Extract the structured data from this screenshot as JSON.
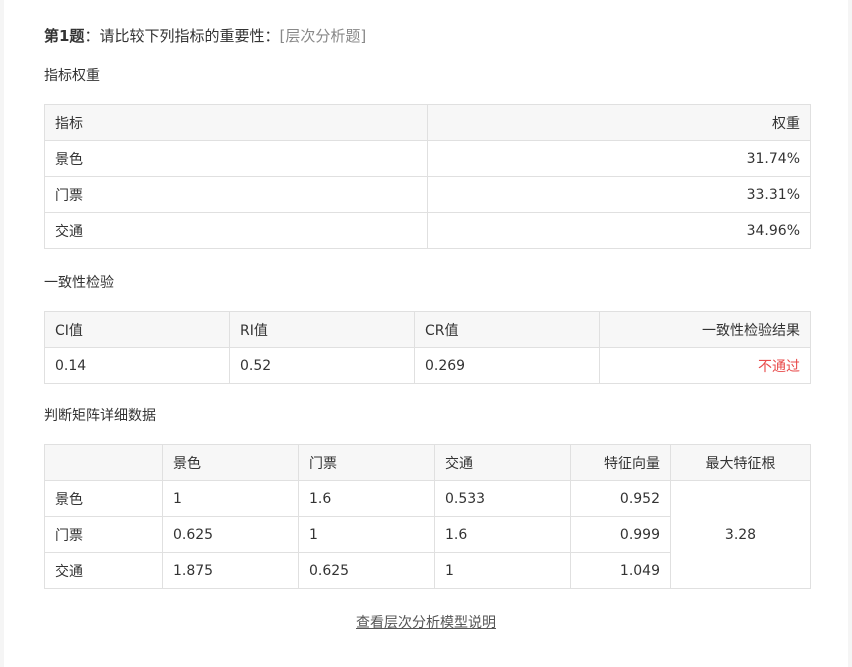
{
  "question": {
    "number": "第1题",
    "colon": "：",
    "text": "请比较下列指标的重要性：",
    "type": "[层次分析题]"
  },
  "weights": {
    "section_title": "指标权重",
    "headers": [
      "指标",
      "权重"
    ],
    "rows": [
      {
        "name": "景色",
        "weight": "31.74%"
      },
      {
        "name": "门票",
        "weight": "33.31%"
      },
      {
        "name": "交通",
        "weight": "34.96%"
      }
    ]
  },
  "consistency": {
    "section_title": "一致性检验",
    "headers": [
      "CI值",
      "RI值",
      "CR值",
      "一致性检验结果"
    ],
    "values": [
      "0.14",
      "0.52",
      "0.269",
      "不通过"
    ],
    "fail_color": "#e84c4c"
  },
  "matrix": {
    "section_title": "判断矩阵详细数据",
    "headers": [
      "",
      "景色",
      "门票",
      "交通",
      "特征向量",
      "最大特征根"
    ],
    "rows": [
      {
        "name": "景色",
        "cells": [
          "1",
          "1.6",
          "0.533"
        ],
        "vector": "0.952"
      },
      {
        "name": "门票",
        "cells": [
          "0.625",
          "1",
          "1.6"
        ],
        "vector": "0.999"
      },
      {
        "name": "交通",
        "cells": [
          "1.875",
          "0.625",
          "1"
        ],
        "vector": "1.049"
      }
    ],
    "max_eigen": "3.28"
  },
  "footer_link": "查看层次分析模型说明"
}
